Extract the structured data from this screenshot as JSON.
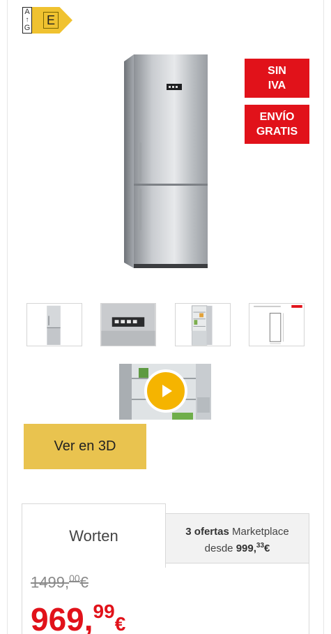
{
  "energy_label": {
    "scale_top": "A",
    "scale_bottom": "G",
    "class": "E",
    "color": "#f0c230"
  },
  "badges": {
    "no_vat": [
      "SIN",
      "IVA"
    ],
    "free_shipping": [
      "ENVÍO",
      "GRATIS"
    ],
    "color": "#e1121a"
  },
  "media": {
    "play_icon": "play-icon",
    "view_3d_label": "Ver en 3D"
  },
  "offers": {
    "seller_tab": "Worten",
    "marketplace": {
      "count_label": "3 ofertas",
      "label": "Marketplace",
      "prefix": "desde",
      "price_int": "999",
      "price_dec": "33",
      "currency": "€"
    },
    "old_price": {
      "int": "1499",
      "sep": ",",
      "dec": "00",
      "currency": "€"
    },
    "price": {
      "int": "969",
      "sep": ",",
      "dec": "99",
      "currency": "€"
    }
  }
}
